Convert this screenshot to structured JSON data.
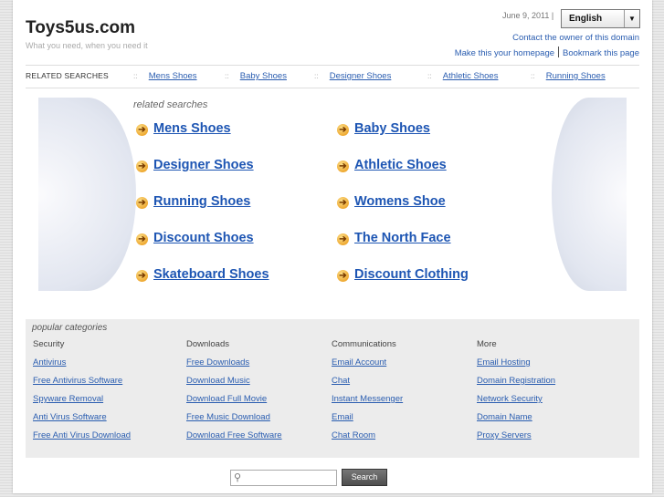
{
  "header": {
    "site_title": "Toys5us.com",
    "tagline": "What you need, when you need it",
    "date": "June 9, 2011 |",
    "language": "English",
    "contact_link": "Contact the owner of this domain",
    "homepage_link": "Make this your homepage",
    "bookmark_link": "Bookmark this page"
  },
  "related_bar": {
    "label": "RELATED SEARCHES",
    "separator": "::",
    "items": [
      "Mens Shoes",
      "Baby Shoes",
      "Designer Shoes",
      "Athletic Shoes",
      "Running Shoes"
    ]
  },
  "related_searches": {
    "heading": "related searches",
    "left": [
      "Mens Shoes",
      "Designer Shoes",
      "Running Shoes",
      "Discount Shoes",
      "Skateboard Shoes"
    ],
    "right": [
      "Baby Shoes",
      "Athletic Shoes",
      "Womens Shoe",
      "The North Face",
      "Discount Clothing"
    ]
  },
  "popular": {
    "title": "popular categories",
    "columns": [
      {
        "head": "Security",
        "links": [
          "Antivirus",
          "Free Antivirus Software",
          "Spyware Removal",
          "Anti Virus Software",
          "Free Anti Virus Download"
        ]
      },
      {
        "head": "Downloads",
        "links": [
          "Free Downloads",
          "Download Music",
          "Download Full Movie",
          "Free Music Download",
          "Download Free Software"
        ]
      },
      {
        "head": "Communications",
        "links": [
          "Email Account",
          "Chat",
          "Instant Messenger",
          "Email",
          "Chat Room"
        ]
      },
      {
        "head": "More",
        "links": [
          "Email Hosting",
          "Domain Registration",
          "Network Security",
          "Domain Name",
          "Proxy Servers"
        ]
      }
    ]
  },
  "search": {
    "button_label": "Search",
    "placeholder": ""
  },
  "icons": {
    "arrow": "arrow-right-circle-icon",
    "search": "magnifier-icon"
  },
  "colors": {
    "link": "#1d55b3",
    "arrow_bullet": "#e8920d",
    "panel": "#ececec"
  }
}
